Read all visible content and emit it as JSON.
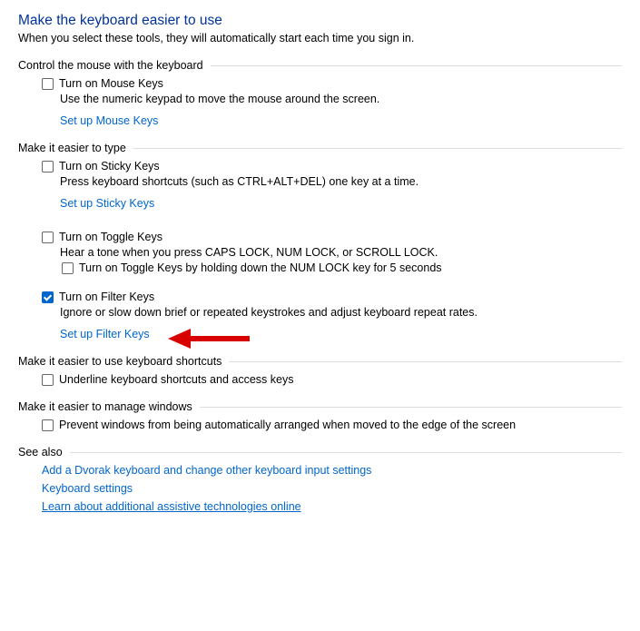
{
  "title": "Make the keyboard easier to use",
  "subtitle": "When you select these tools, they will automatically start each time you sign in.",
  "groups": {
    "mouse": {
      "header": "Control the mouse with the keyboard",
      "mouse_keys_label": "Turn on Mouse Keys",
      "mouse_keys_desc": "Use the numeric keypad to move the mouse around the screen.",
      "mouse_keys_link": "Set up Mouse Keys"
    },
    "type": {
      "header": "Make it easier to type",
      "sticky_label": "Turn on Sticky Keys",
      "sticky_desc": "Press keyboard shortcuts (such as CTRL+ALT+DEL) one key at a time.",
      "sticky_link": "Set up Sticky Keys",
      "toggle_label": "Turn on Toggle Keys",
      "toggle_desc": "Hear a tone when you press CAPS LOCK, NUM LOCK, or SCROLL LOCK.",
      "toggle_hold_label": "Turn on Toggle Keys by holding down the NUM LOCK key for 5 seconds",
      "filter_label": "Turn on Filter Keys",
      "filter_desc": "Ignore or slow down brief or repeated keystrokes and adjust keyboard repeat rates.",
      "filter_link": "Set up Filter Keys"
    },
    "shortcuts": {
      "header": "Make it easier to use keyboard shortcuts",
      "underline_label": "Underline keyboard shortcuts and access keys"
    },
    "windows": {
      "header": "Make it easier to manage windows",
      "prevent_label": "Prevent windows from being automatically arranged when moved to the edge of the screen"
    },
    "seealso": {
      "header": "See also",
      "dvorak": "Add a Dvorak keyboard and change other keyboard input settings",
      "kbd": "Keyboard settings",
      "learn": "Learn about additional assistive technologies online"
    }
  },
  "annotation": {
    "arrow_color": "#d90000"
  }
}
